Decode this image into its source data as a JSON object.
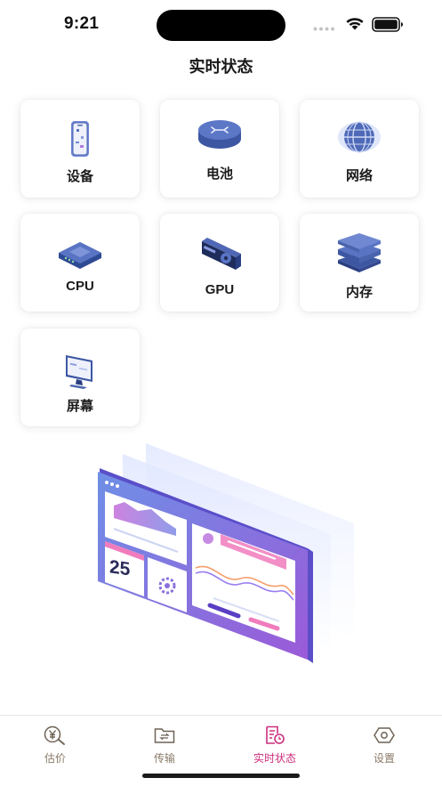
{
  "status_bar": {
    "time": "9:21",
    "icons": [
      "signal-dots-icon",
      "wifi-icon",
      "battery-icon"
    ]
  },
  "header": {
    "title": "实时状态"
  },
  "cards": [
    {
      "label": "设备",
      "icon": "phone-icon"
    },
    {
      "label": "电池",
      "icon": "router-icon"
    },
    {
      "label": "网络",
      "icon": "globe-icon"
    },
    {
      "label": "CPU",
      "icon": "cpu-chip-icon"
    },
    {
      "label": "GPU",
      "icon": "graphics-card-icon"
    },
    {
      "label": "内存",
      "icon": "memory-stack-icon"
    },
    {
      "label": "屏幕",
      "icon": "monitor-icon"
    }
  ],
  "illustration": {
    "number": "25"
  },
  "tabbar": {
    "tabs": [
      {
        "label": "估价",
        "icon": "yen-search-icon",
        "active": false
      },
      {
        "label": "传输",
        "icon": "folder-transfer-icon",
        "active": false
      },
      {
        "label": "实时状态",
        "icon": "realtime-report-icon",
        "active": true
      },
      {
        "label": "设置",
        "icon": "settings-hexagon-icon",
        "active": false
      }
    ]
  },
  "colors": {
    "accent": "#cc2f7c",
    "inactive": "#8a7b68",
    "icon_blue": "#4a64ad"
  }
}
